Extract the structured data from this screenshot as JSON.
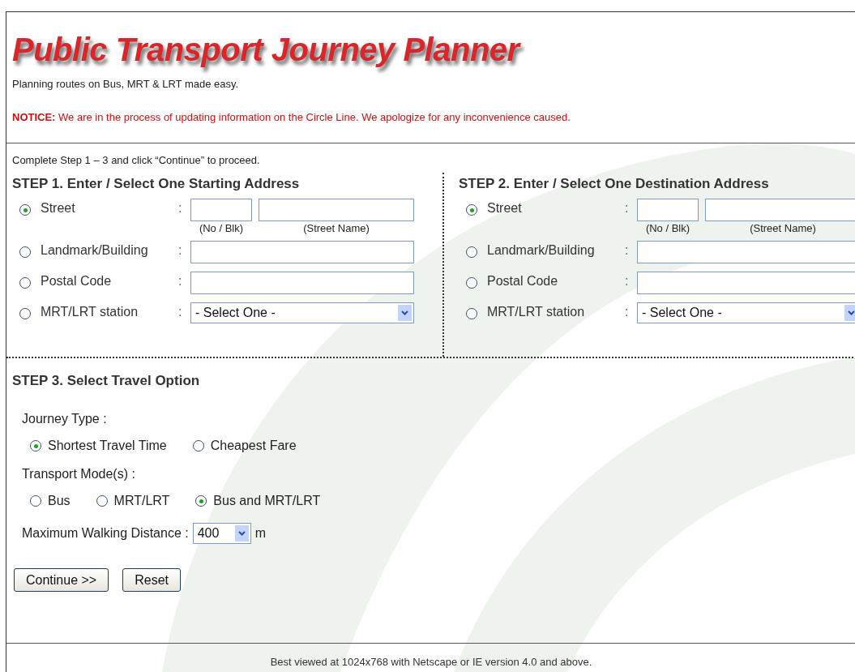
{
  "title": "Public Transport Journey Planner",
  "tagline": "Planning routes on Bus, MRT & LRT made easy.",
  "notice": "**NOTICE:** We are in the process of updating information on the Circle Line. We apologize for any inconvenience caused.",
  "instruction": "Complete Step 1 – 3 and click “Continue” to proceed.",
  "steps": [
    {
      "heading": "STEP 1. Enter / Select One Starting Address",
      "options": [
        {
          "kind": "street",
          "label": "Street",
          "separator": ":",
          "selected": true,
          "hints": [
            "(No / Blk)",
            "(Street Name)"
          ]
        },
        {
          "kind": "text",
          "label": "Landmark/Building",
          "separator": ":",
          "selected": false
        },
        {
          "kind": "text",
          "label": "Postal Code",
          "separator": ":",
          "selected": false
        },
        {
          "kind": "select",
          "label": "MRT/LRT station",
          "separator": ":",
          "selected": false,
          "value": "- Select One -"
        }
      ]
    },
    {
      "heading": "STEP 2. Enter / Select One Destination Address",
      "options": [
        {
          "kind": "street",
          "label": "Street",
          "separator": ":",
          "selected": true,
          "hints": [
            "(No / Blk)",
            "(Street Name)"
          ]
        },
        {
          "kind": "text",
          "label": "Landmark/Building",
          "separator": ":",
          "selected": false
        },
        {
          "kind": "text",
          "label": "Postal Code",
          "separator": ":",
          "selected": false
        },
        {
          "kind": "select",
          "label": "MRT/LRT station",
          "separator": ":",
          "selected": false,
          "value": "- Select One -"
        }
      ]
    }
  ],
  "step3": {
    "heading": "STEP 3. Select Travel Option",
    "journey_type": {
      "label": "Journey Type :",
      "options": [
        {
          "label": "Shortest Travel Time",
          "selected": true
        },
        {
          "label": "Cheapest Fare",
          "selected": false
        }
      ]
    },
    "transport_modes": {
      "label": "Transport Mode(s) :",
      "options": [
        {
          "label": "Bus",
          "selected": false
        },
        {
          "label": "MRT/LRT",
          "selected": false
        },
        {
          "label": "Bus and MRT/LRT",
          "selected": true
        }
      ]
    },
    "walking": {
      "label": "Maximum Walking Distance :",
      "value": "400",
      "unit": "m"
    }
  },
  "buttons": [
    "Continue >>",
    "Reset"
  ],
  "footer": "Best viewed at 1024x768 with Netscape or IE version 4.0 and above."
}
